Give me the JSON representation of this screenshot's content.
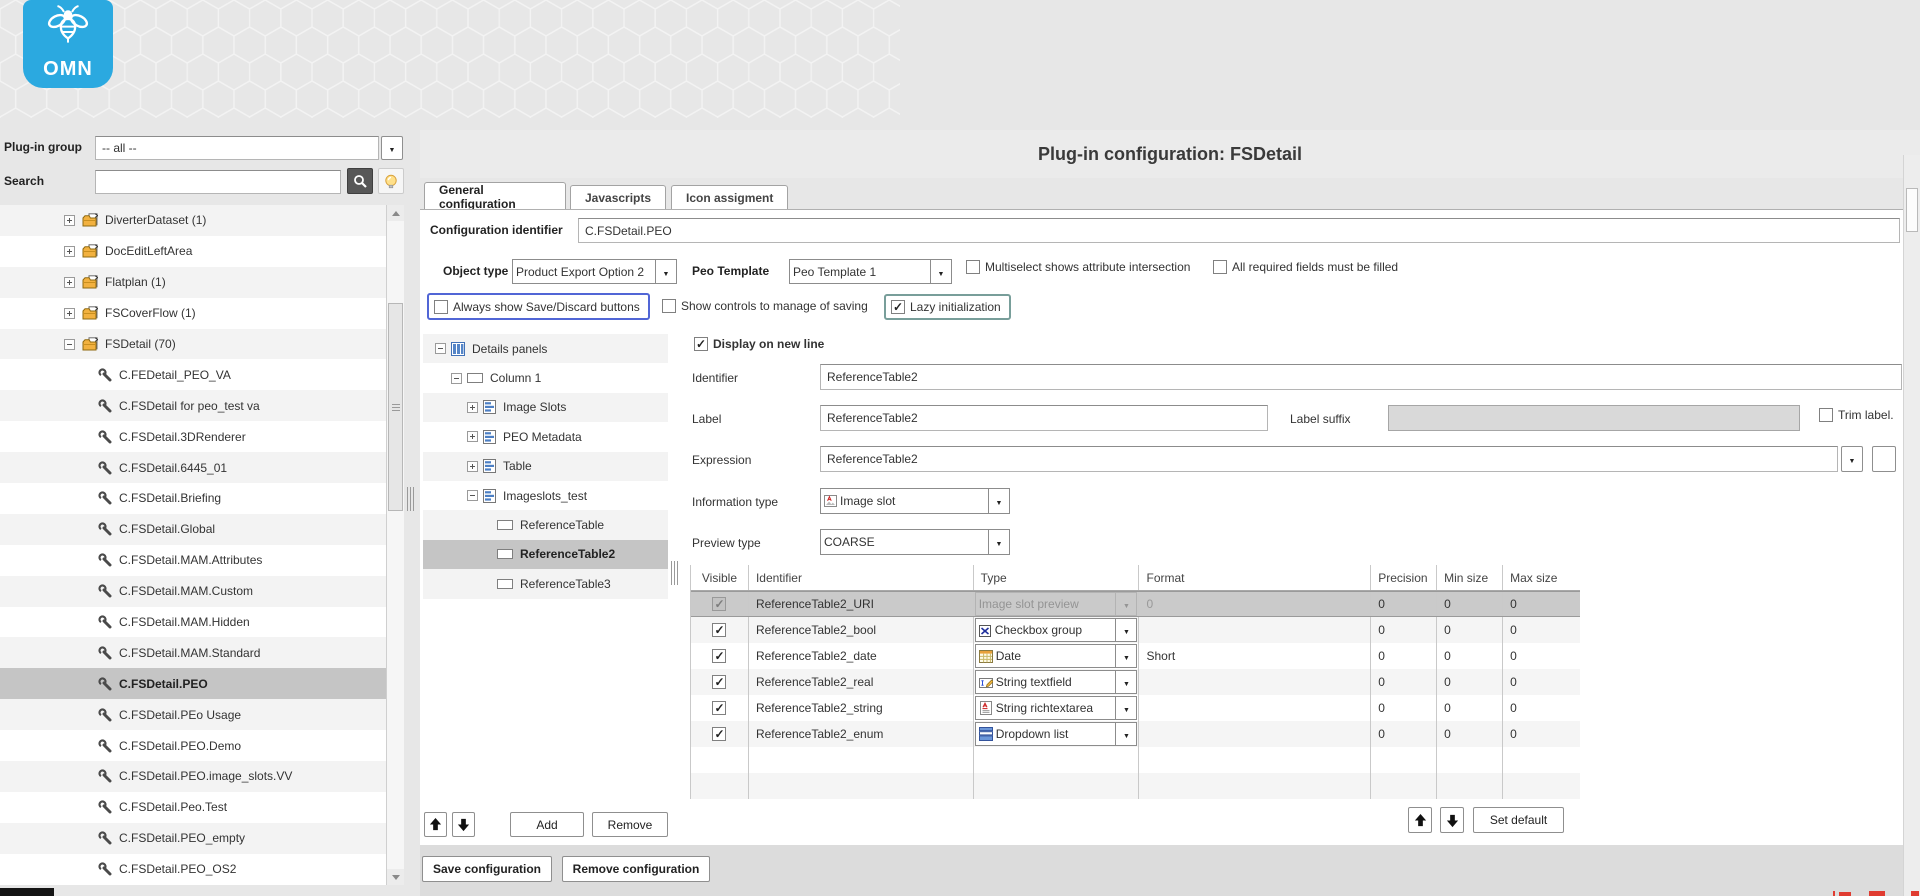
{
  "logo": {
    "text": "OMN"
  },
  "colors": {
    "logo_blue": "#2BA9E0",
    "focus_blue": "#5166D6",
    "focus_teal": "#789E9A",
    "selection_gray": "#C5C5C5"
  },
  "sidebar": {
    "plugin_group_label": "Plug-in group",
    "plugin_group_value": "-- all --",
    "search_label": "Search",
    "search_value": "",
    "tree": [
      {
        "label": "DiverterDataset (1)"
      },
      {
        "label": "DocEditLeftArea"
      },
      {
        "label": "Flatplan (1)"
      },
      {
        "label": "FSCoverFlow (1)"
      },
      {
        "label": "FSDetail (70)"
      },
      {
        "label": "C.FEDetail_PEO_VA"
      },
      {
        "label": "C.FSDetail for peo_test va"
      },
      {
        "label": "C.FSDetail.3DRenderer"
      },
      {
        "label": "C.FSDetail.6445_01"
      },
      {
        "label": "C.FSDetail.Briefing"
      },
      {
        "label": "C.FSDetail.Global"
      },
      {
        "label": "C.FSDetail.MAM.Attributes"
      },
      {
        "label": "C.FSDetail.MAM.Custom"
      },
      {
        "label": "C.FSDetail.MAM.Hidden"
      },
      {
        "label": "C.FSDetail.MAM.Standard"
      },
      {
        "label": "C.FSDetail.PEO"
      },
      {
        "label": "C.FSDetail.PEo Usage"
      },
      {
        "label": "C.FSDetail.PEO.Demo"
      },
      {
        "label": "C.FSDetail.PEO.image_slots.VV"
      },
      {
        "label": "C.FSDetail.Peo.Test"
      },
      {
        "label": "C.FSDetail.PEO_empty"
      },
      {
        "label": "C.FSDetail.PEO_OS2"
      }
    ]
  },
  "header": {
    "title": "Plug-in configuration: FSDetail"
  },
  "tabs": {
    "general": "General configuration",
    "javascripts": "Javascripts",
    "icon_assignment": "Icon assigment"
  },
  "general": {
    "config_identifier_label": "Configuration identifier",
    "config_identifier_value": "C.FSDetail.PEO",
    "object_type_label": "Object type",
    "object_type_value": "Product Export Option 2",
    "peo_template_label": "Peo Template",
    "peo_template_value": "Peo Template 1",
    "cb_multiselect": "Multiselect shows attribute intersection",
    "cb_required": "All required fields must be filled",
    "cb_always_show": "Always show Save/Discard buttons",
    "cb_show_controls": "Show controls to manage of saving",
    "cb_lazy": "Lazy initialization"
  },
  "details_tree": {
    "items": [
      "Details panels",
      "Column 1",
      "Image Slots",
      "PEO Metadata",
      "Table",
      "Imageslots_test",
      "ReferenceTable",
      "ReferenceTable2",
      "ReferenceTable3"
    ]
  },
  "panel": {
    "display_on_new_line": "Display on new line",
    "identifier_label": "Identifier",
    "identifier_value": "ReferenceTable2",
    "label_label": "Label",
    "label_value": "ReferenceTable2",
    "label_suffix_label": "Label suffix",
    "label_suffix_value": "",
    "trim_label": "Trim label.",
    "expression_label": "Expression",
    "expression_value": "ReferenceTable2",
    "information_type_label": "Information type",
    "information_type_value": "Image slot",
    "preview_type_label": "Preview type",
    "preview_type_value": "COARSE"
  },
  "table": {
    "headers": [
      "Visible",
      "Identifier",
      "Type",
      "Format",
      "Precision",
      "Min size",
      "Max size"
    ],
    "rows": [
      {
        "identifier": "ReferenceTable2_URI",
        "type": "Image slot preview",
        "format": "0",
        "precision": "0",
        "min": "0",
        "max": "0"
      },
      {
        "identifier": "ReferenceTable2_bool",
        "type": "Checkbox group",
        "format": "",
        "precision": "0",
        "min": "0",
        "max": "0"
      },
      {
        "identifier": "ReferenceTable2_date",
        "type": "Date",
        "format": "Short",
        "precision": "0",
        "min": "0",
        "max": "0"
      },
      {
        "identifier": "ReferenceTable2_real",
        "type": "String textfield",
        "format": "",
        "precision": "0",
        "min": "0",
        "max": "0"
      },
      {
        "identifier": "ReferenceTable2_string",
        "type": "String richtextarea",
        "format": "",
        "precision": "0",
        "min": "0",
        "max": "0"
      },
      {
        "identifier": "ReferenceTable2_enum",
        "type": "Dropdown list",
        "format": "",
        "precision": "0",
        "min": "0",
        "max": "0"
      }
    ]
  },
  "buttons": {
    "add": "Add",
    "remove": "Remove",
    "set_default": "Set default",
    "save_configuration": "Save configuration",
    "remove_configuration": "Remove configuration"
  }
}
